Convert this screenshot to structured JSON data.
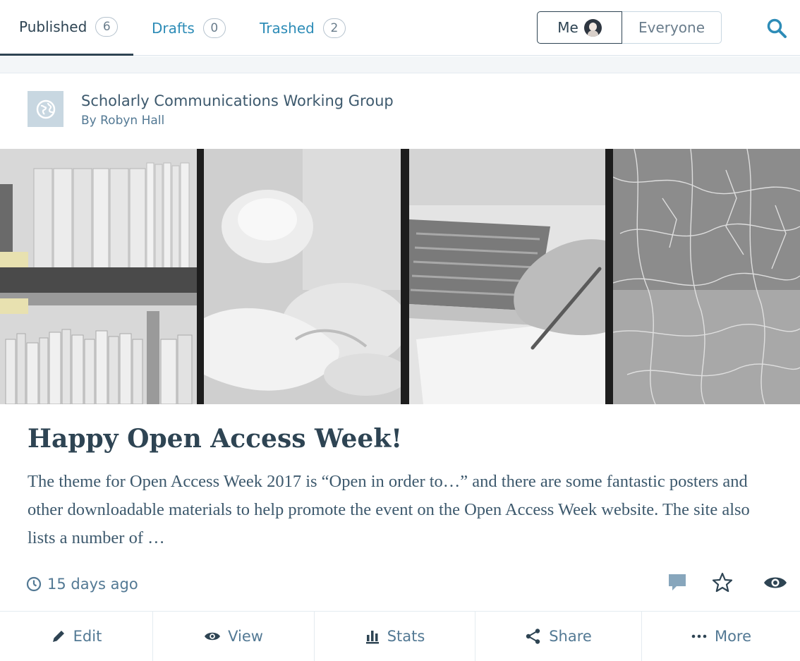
{
  "nav": {
    "tabs": [
      {
        "label": "Published",
        "count": "6"
      },
      {
        "label": "Drafts",
        "count": "0"
      },
      {
        "label": "Trashed",
        "count": "2"
      }
    ],
    "author_filter": {
      "me": "Me",
      "everyone": "Everyone"
    },
    "search_icon": "search-icon"
  },
  "post": {
    "site_name": "Scholarly Communications Working Group",
    "byline": "By Robyn Hall",
    "title": "Happy Open Access Week!",
    "excerpt": "The theme for Open Access Week 2017 is “Open in order to…” and there are some fantastic posters and other downloadable materials to help promote the event on the Open Access Week website. The site also lists a number of …",
    "time": "15 days ago"
  },
  "actions": [
    {
      "label": "Edit",
      "icon": "pencil-icon"
    },
    {
      "label": "View",
      "icon": "eye-icon"
    },
    {
      "label": "Stats",
      "icon": "stats-icon"
    },
    {
      "label": "Share",
      "icon": "share-icon"
    },
    {
      "label": "More",
      "icon": "ellipsis-icon"
    }
  ],
  "colors": {
    "accent": "#2d8cb7",
    "text_primary": "#2e4453",
    "text_secondary": "#537994",
    "icon_muted": "#87a6bc"
  }
}
